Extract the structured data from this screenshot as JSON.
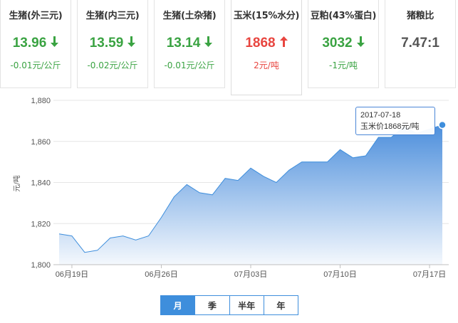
{
  "cards": [
    {
      "name": "生猪(外三元)",
      "price": "13.96",
      "change": "-0.01元/公斤",
      "trend": "down"
    },
    {
      "name": "生猪(内三元)",
      "price": "13.59",
      "change": "-0.02元/公斤",
      "trend": "down"
    },
    {
      "name": "生猪(土杂猪)",
      "price": "13.14",
      "change": "-0.01元/公斤",
      "trend": "down"
    },
    {
      "name": "玉米(15%水分)",
      "price": "1868",
      "change": "2元/吨",
      "trend": "up"
    },
    {
      "name": "豆粕(43%蛋白)",
      "price": "3032",
      "change": "-1元/吨",
      "trend": "down"
    },
    {
      "name": "猪粮比",
      "price": "7.47:1",
      "change": "",
      "trend": "none"
    }
  ],
  "colors": {
    "down": "#3aa342",
    "up": "#e8453f",
    "accent": "#3e8edc",
    "area_top": "#4d8fdc",
    "area_bottom": "#f4f8fd"
  },
  "tooltip": {
    "date": "2017-07-18",
    "text": "玉米价1868元/吨"
  },
  "range_tabs": [
    {
      "label": "月",
      "active": true
    },
    {
      "label": "季",
      "active": false
    },
    {
      "label": "半年",
      "active": false
    },
    {
      "label": "年",
      "active": false
    }
  ],
  "chart_data": {
    "type": "area",
    "ylabel": "元/吨",
    "ylim": [
      1800,
      1880
    ],
    "yticks": [
      "1,800",
      "1,820",
      "1,840",
      "1,860",
      "1,880"
    ],
    "xticks": [
      "06月19日",
      "06月26日",
      "07月03日",
      "07月10日",
      "07月17日"
    ],
    "grid": true,
    "series": [
      {
        "values": [
          1815,
          1814,
          1806,
          1807,
          1813,
          1814,
          1812,
          1814,
          1823,
          1833,
          1839,
          1835,
          1834,
          1842,
          1841,
          1847,
          1843,
          1840,
          1846,
          1850,
          1850,
          1850,
          1856,
          1852,
          1853,
          1862,
          1862,
          1867,
          1864,
          1866,
          1868
        ]
      }
    ]
  }
}
